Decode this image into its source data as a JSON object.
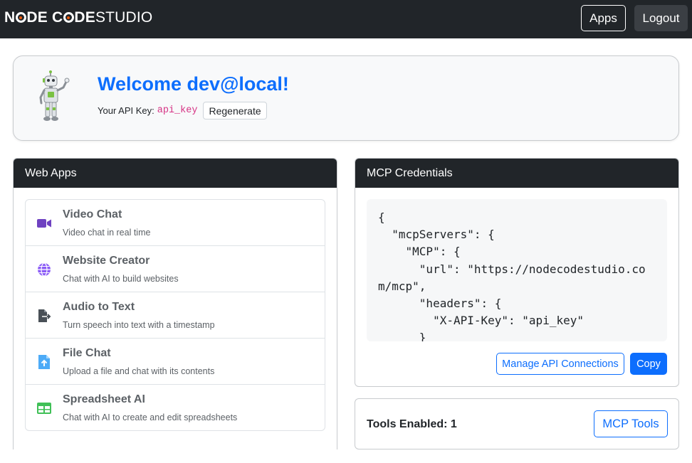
{
  "navbar": {
    "brand_bold_1": "N",
    "brand_bold_2": "DE C",
    "brand_bold_3": "DE",
    "brand_light": "STUDIO",
    "apps_label": "Apps",
    "logout_label": "Logout"
  },
  "welcome": {
    "title": "Welcome dev@local!",
    "api_key_label": "Your API Key:",
    "api_key_value": "api_key",
    "regenerate_label": "Regenerate"
  },
  "web_apps": {
    "header": "Web Apps",
    "items": [
      {
        "title": "Video Chat",
        "description": "Video chat in real time",
        "icon": "video-camera-icon",
        "color": "#6f42c1"
      },
      {
        "title": "Website Creator",
        "description": "Chat with AI to build websites",
        "icon": "globe-icon",
        "color": "#8b5cf6"
      },
      {
        "title": "Audio to Text",
        "description": "Turn speech into text with a timestamp",
        "icon": "file-export-icon",
        "color": "#495057"
      },
      {
        "title": "File Chat",
        "description": "Upload a file and chat with its contents",
        "icon": "file-upload-icon",
        "color": "#4dabf7"
      },
      {
        "title": "Spreadsheet AI",
        "description": "Chat with AI to create and edit spreadsheets",
        "icon": "table-icon",
        "color": "#40c057"
      }
    ]
  },
  "mcp": {
    "header": "MCP Credentials",
    "code": "{\n  \"mcpServers\": {\n    \"MCP\": {\n      \"url\": \"https://nodecodestudio.co\nm/mcp\",\n      \"headers\": {\n        \"X-API-Key\": \"api_key\"\n      }",
    "manage_label": "Manage API Connections",
    "copy_label": "Copy"
  },
  "tools": {
    "label": "Tools Enabled: 1",
    "button_label": "MCP Tools"
  },
  "colors": {
    "navbar": "#212529",
    "primary": "#0d6efd",
    "code_pink": "#d63384"
  }
}
